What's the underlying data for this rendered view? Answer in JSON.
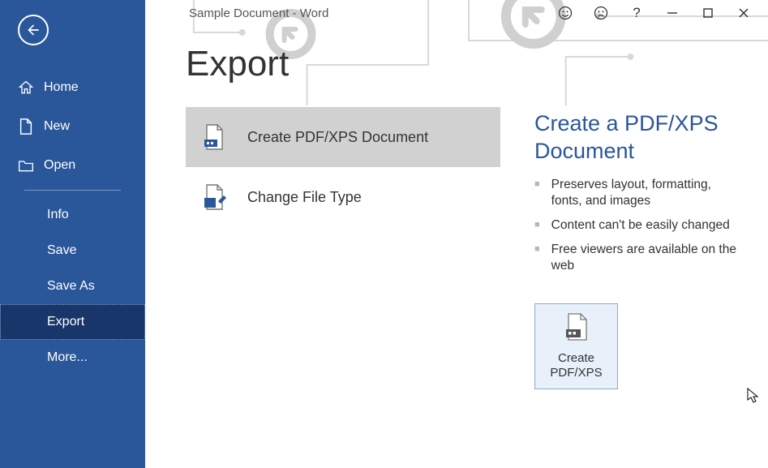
{
  "title_bar": {
    "document_label": "Sample Document  -  Word"
  },
  "sidebar": {
    "items": [
      {
        "label": "Home"
      },
      {
        "label": "New"
      },
      {
        "label": "Open"
      }
    ],
    "sub_items": [
      {
        "label": "Info"
      },
      {
        "label": "Save"
      },
      {
        "label": "Save As"
      },
      {
        "label": "Export"
      },
      {
        "label": "More..."
      }
    ]
  },
  "page": {
    "heading": "Export"
  },
  "export_options": [
    {
      "label": "Create PDF/XPS Document"
    },
    {
      "label": "Change File Type"
    }
  ],
  "detail": {
    "title": "Create a PDF/XPS Document",
    "bullets": [
      "Preserves layout, formatting, fonts, and images",
      "Content can't be easily changed",
      "Free viewers are available on the web"
    ],
    "button_line1": "Create",
    "button_line2": "PDF/XPS"
  }
}
